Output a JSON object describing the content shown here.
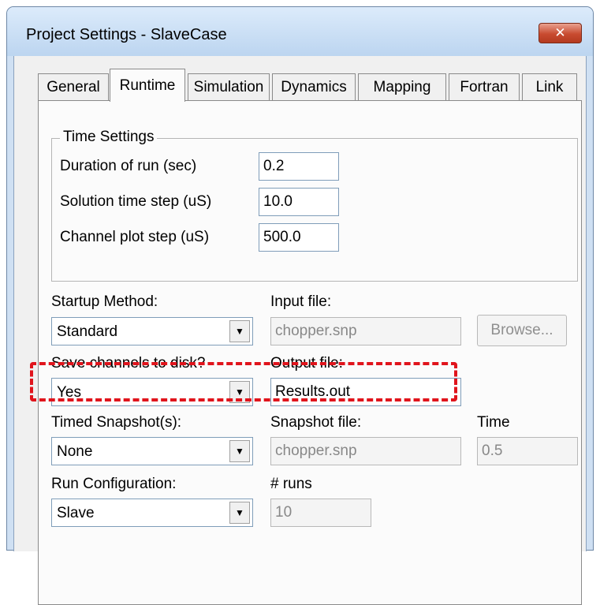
{
  "window": {
    "title": "Project Settings - SlaveCase",
    "close_glyph": "✕"
  },
  "tabs": [
    {
      "label": "General",
      "active": false
    },
    {
      "label": "Runtime",
      "active": true
    },
    {
      "label": "Simulation",
      "active": false
    },
    {
      "label": "Dynamics",
      "active": false
    },
    {
      "label": "Mapping",
      "active": false
    },
    {
      "label": "Fortran",
      "active": false
    },
    {
      "label": "Link",
      "active": false
    }
  ],
  "time_settings": {
    "legend": "Time Settings",
    "duration_label": "Duration of run (sec)",
    "duration_value": "0.2",
    "timestep_label": "Solution time step (uS)",
    "timestep_value": "10.0",
    "plotstep_label": "Channel plot step (uS)",
    "plotstep_value": "500.0"
  },
  "startup": {
    "label": "Startup Method:",
    "value": "Standard",
    "input_file_label": "Input file:",
    "input_file_value": "chopper.snp",
    "browse_label": "Browse..."
  },
  "save_channels": {
    "label": "Save channels to disk?",
    "value": "Yes",
    "output_file_label": "Output file:",
    "output_file_value": "Results.out"
  },
  "snapshot": {
    "label": "Timed Snapshot(s):",
    "value": "None",
    "file_label": "Snapshot file:",
    "file_value": "chopper.snp",
    "time_label": "Time",
    "time_value": "0.5"
  },
  "run_config": {
    "label": "Run Configuration:",
    "value": "Slave",
    "runs_label": "# runs",
    "runs_value": "10"
  },
  "colors": {
    "highlight": "#e0141c",
    "close_button": "#c84b30",
    "frame": "#cfe0f3"
  },
  "icons": {
    "dropdown": "chevron-down-icon",
    "close": "close-icon"
  }
}
